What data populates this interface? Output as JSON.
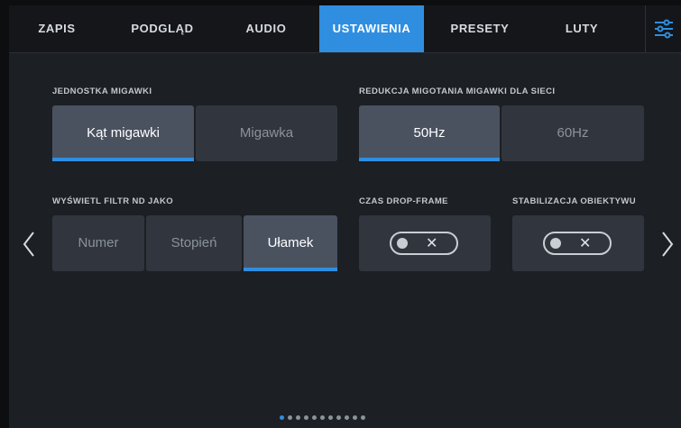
{
  "tabs": [
    {
      "label": "ZAPIS",
      "active": false
    },
    {
      "label": "PODGLĄD",
      "active": false
    },
    {
      "label": "AUDIO",
      "active": false
    },
    {
      "label": "USTAWIENIA",
      "active": true
    },
    {
      "label": "PRESETY",
      "active": false
    },
    {
      "label": "LUTY",
      "active": false
    }
  ],
  "menu_icon": "sliders-icon",
  "accent_color": "#2f8ee0",
  "shutter_unit": {
    "label": "JEDNOSTKA MIGAWKI",
    "options": [
      "Kąt migawki",
      "Migawka"
    ],
    "selected": "Kąt migawki"
  },
  "flicker": {
    "label": "REDUKCJA MIGOTANIA MIGAWKI DLA SIECI",
    "options": [
      "50Hz",
      "60Hz"
    ],
    "selected": "50Hz"
  },
  "nd_filter": {
    "label": "WYŚWIETL FILTR ND JAKO",
    "options": [
      "Numer",
      "Stopień",
      "Ułamek"
    ],
    "selected": "Ułamek"
  },
  "drop_frame": {
    "label": "CZAS DROP-FRAME",
    "value": "off",
    "glyph": "✕"
  },
  "stabilization": {
    "label": "STABILIZACJA OBIEKTYWU",
    "value": "off",
    "glyph": "✕"
  },
  "pagination": {
    "total": 11,
    "current": 1
  }
}
